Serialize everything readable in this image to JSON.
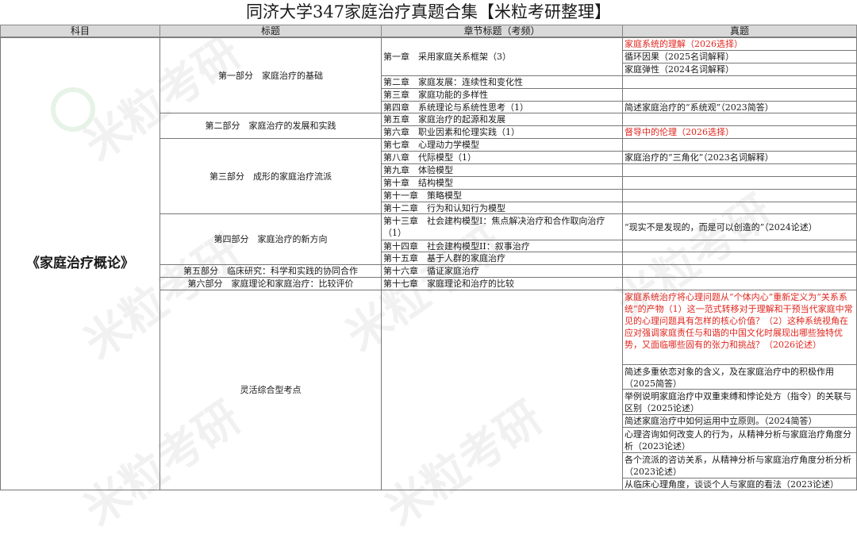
{
  "title": "同济大学347家庭治疗真题合集【米粒考研整理】",
  "headers": {
    "subject": "科目",
    "part": "标题",
    "chapter": "章节标题（考频）",
    "questions": "真题"
  },
  "subject": "《家庭治疗概论》",
  "parts": [
    "第一部分　家庭治疗的基础",
    "第二部分　家庭治疗的发展和实践",
    "第三部分　成形的家庭治疗流派",
    "第四部分　家庭治疗的新方向",
    "第五部分　临床研究：科学和实践的协同合作",
    "第六部分　家庭理论和家庭治疗：比较评价",
    "灵活综合型考点"
  ],
  "chapters": [
    "第一章　采用家庭关系框架（3）",
    "第二章　家庭发展：连续性和变化性",
    "第三章　家庭功能的多样性",
    "第四章　系统理论与系统性思考（1）",
    "第五章　家庭治疗的起源和发展",
    "第六章　职业因素和伦理实践（1）",
    "第七章　心理动力学模型",
    "第八章　代际模型（1）",
    "第九章　体验模型",
    "第十章　结构模型",
    "第十一章　策略模型",
    "第十二章　行为和认知行为模型",
    "第十三章　社会建构模型I：焦点解决治疗和合作取向治疗（1）",
    "第十四章　社会建构模型II：叙事治疗",
    "第十五章　基于人群的家庭治疗",
    "第十六章　循证家庭治疗",
    "第十七章　家庭理论和治疗的比较"
  ],
  "questions": [
    "家庭系统的理解（2026选择）",
    "循环因果（2025名词解释）",
    "家庭弹性（2024名词解释）",
    "简述家庭治疗的“系统观”（2023简答）",
    "督导中的伦理（2026选择）",
    "家庭治疗的“三角化”（2023名词解释）",
    "“现实不是发现的，而是可以创造的”（2024论述）",
    "家庭系统治疗将心理问题从“个体内心”重新定义为“关系系统”的产物（1）这一范式转移对于理解和干预当代家庭中常见的心理问题具有怎样的核心价值？（2）这种系统视角在应对强调家庭责任与和谐的中国文化时展现出哪些独特优势，又面临哪些固有的张力和挑战？（2026论述）",
    "简述多重依恋对象的含义，及在家庭治疗中的积极作用（2025简答）",
    "举例说明家庭治疗中双重束缚和悖论处方（指令）的关联与区别（2025论述）",
    "简述家庭治疗中如何运用中立原则。（2024简答）",
    "心理咨询如何改变人的行为，从精神分析与家庭治疗角度分析（2023论述）",
    "各个流派的咨访关系，从精神分析与家庭治疗角度分析分析（2023论述）",
    "从临床心理角度，谈谈个人与家庭的看法（2023论述）"
  ],
  "watermark": "米粒考研",
  "colors": {
    "header_bg": "#d9d9d9",
    "highlight_red": "#e0261e",
    "border": "#777777"
  }
}
